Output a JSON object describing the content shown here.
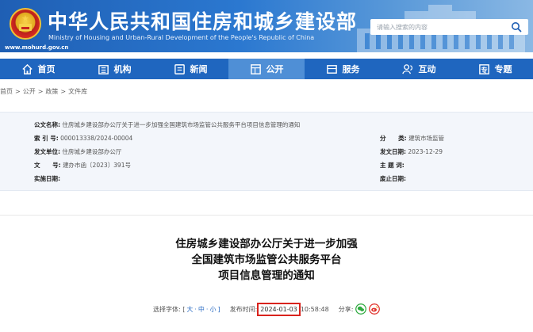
{
  "header": {
    "title": "中华人民共和国住房和城乡建设部",
    "subtitle": "Ministry of Housing and Urban-Rural Development of the People's Republic of China",
    "url": "www.mohurd.gov.cn",
    "search_placeholder": "请输入搜索的内容",
    "brand_color": "#1f5fb4"
  },
  "nav": {
    "items": [
      {
        "label": "首页",
        "icon": "home-icon"
      },
      {
        "label": "机构",
        "icon": "org-icon"
      },
      {
        "label": "新闻",
        "icon": "news-icon"
      },
      {
        "label": "公开",
        "icon": "open-icon",
        "active": true
      },
      {
        "label": "服务",
        "icon": "service-icon"
      },
      {
        "label": "互动",
        "icon": "interact-icon"
      },
      {
        "label": "专题",
        "icon": "topic-icon"
      }
    ]
  },
  "breadcrumb": [
    "首页",
    "公开",
    "政策",
    "文件库"
  ],
  "meta": {
    "index_title_label": "公文名称:",
    "index_title_value": "住房城乡建设部办公厅关于进一步加强全国建筑市场监管公共服务平台项目信息管理的通知",
    "index_no_label": "索 引 号:",
    "index_no_value": "000013338/2024-00004",
    "issuer_label": "发文单位:",
    "issuer_value": "住房城乡建设部办公厅",
    "doc_no_label": "文      号:",
    "doc_no_value": "建办市函〔2023〕391号",
    "effective_label": "实施日期:",
    "effective_value": "",
    "category_label": "分      类:",
    "category_value": "建筑市场监管",
    "date_label": "发文日期:",
    "date_value": "2023-12-29",
    "keyword_label": "主 题 词:",
    "keyword_value": "",
    "expire_label": "废止日期:",
    "expire_value": ""
  },
  "article": {
    "title_line1": "住房城乡建设部办公厅关于进一步加强",
    "title_line2": "全国建筑市场监管公共服务平台",
    "title_line3": "项目信息管理的通知"
  },
  "toolbar": {
    "font_size_label": "选择字体: [",
    "font_large": "大",
    "font_medium": "中",
    "font_small": "小",
    "bracket_close": "]",
    "dot": "·",
    "publish_label": "发布时间:",
    "publish_date": "2024-01-03",
    "publish_time": "10:58:48",
    "share_label": "分享:",
    "highlight_color": "#d9231d"
  }
}
